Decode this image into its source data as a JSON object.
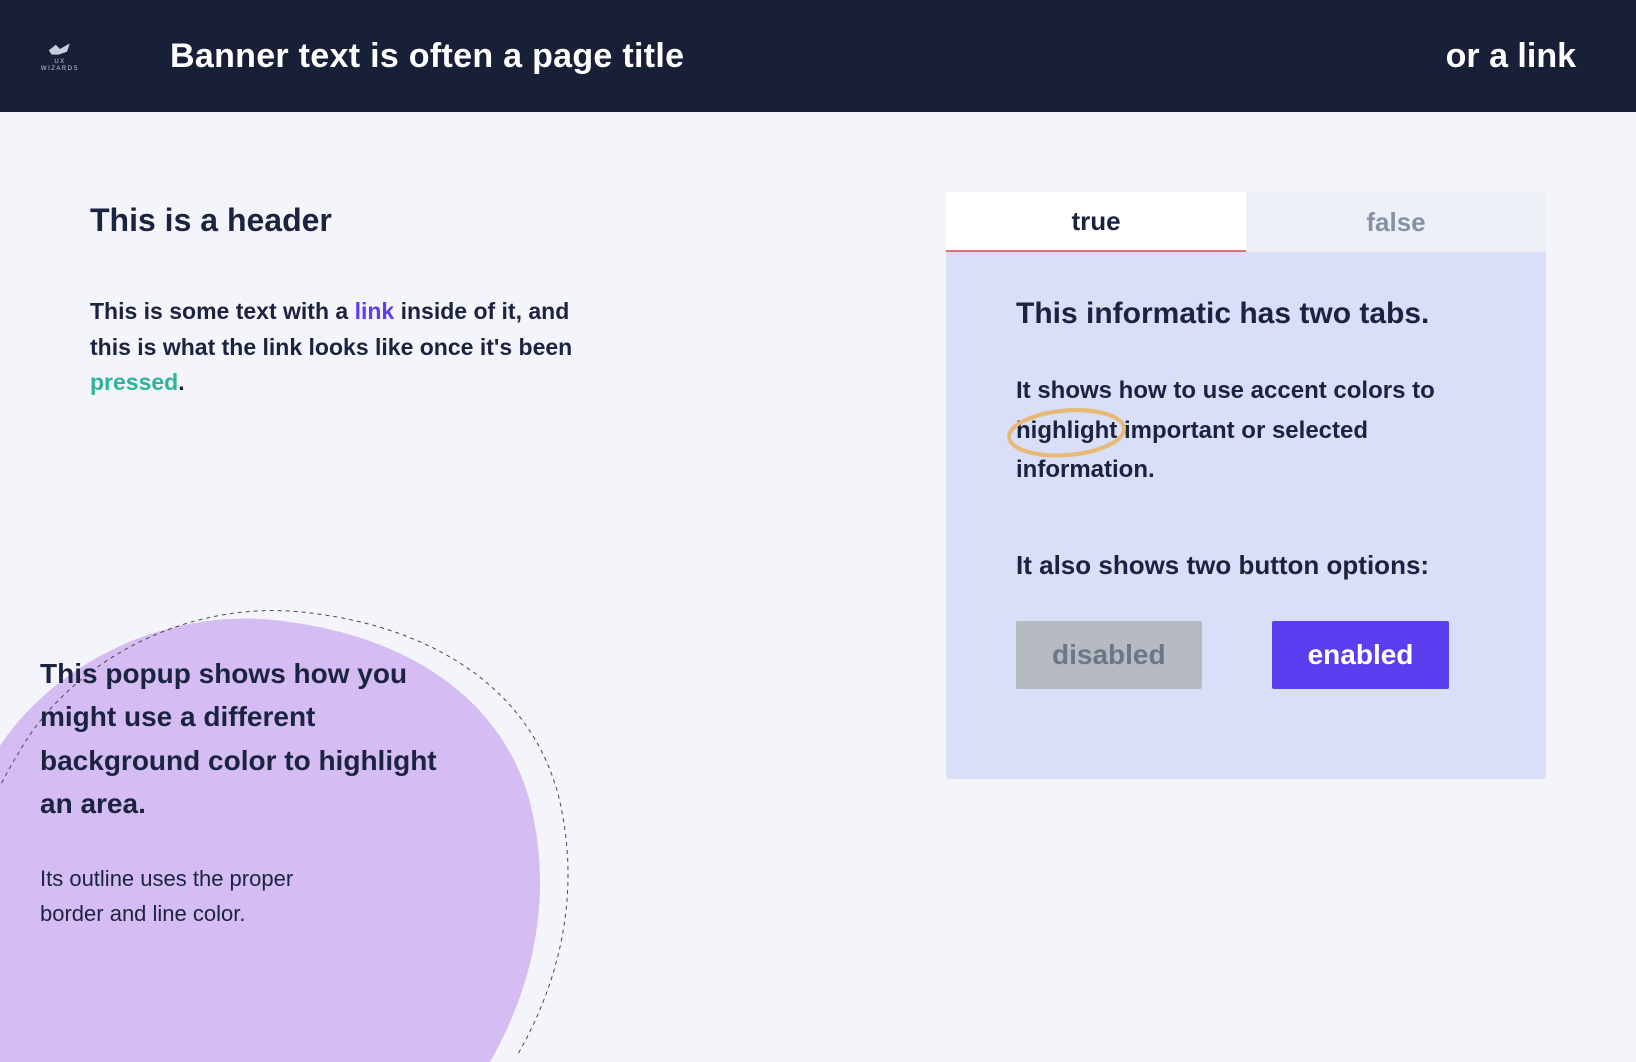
{
  "banner": {
    "logo_label": "UX",
    "logo_sub": "WIZARDS",
    "title": "Banner text is often a page title",
    "link": "or a link"
  },
  "left": {
    "header": "This is a header",
    "text_before_link": "This is some text with a ",
    "link_word": "link",
    "text_mid": " inside of it, and this is what the link looks like once it's been ",
    "pressed_word": "pressed",
    "text_after": "."
  },
  "popup": {
    "title": "This popup shows how you might use a different background color to highlight an area.",
    "body": "Its outline uses the proper border and line color."
  },
  "card": {
    "tab_true": "true",
    "tab_false": "false",
    "title": "This informatic has two tabs.",
    "line1_before": "It shows how to use accent colors to ",
    "highlight_word": "highlight",
    "line1_after": " important or selected information.",
    "sub": "It also shows two button options:",
    "btn_disabled": "disabled",
    "btn_enabled": "enabled"
  },
  "colors": {
    "accent_circle": "#e8b974",
    "popup_fill": "#d5bdf4",
    "popup_border": "#4a4a4a"
  }
}
